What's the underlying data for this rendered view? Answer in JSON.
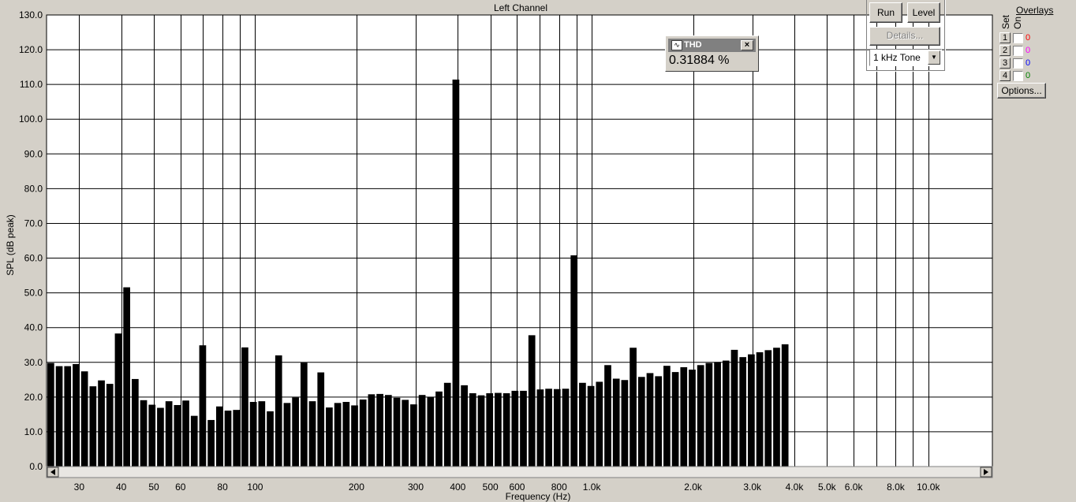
{
  "chart_data": {
    "type": "bar",
    "title": "Left Channel",
    "xlabel": "Frequency (Hz)",
    "ylabel": "SPL (dB peak)",
    "x_scale": "log",
    "xlim": [
      24,
      15500
    ],
    "ylim": [
      0,
      130
    ],
    "grid": true,
    "y_ticks": [
      "0.0",
      "10.0",
      "20.0",
      "30.0",
      "40.0",
      "50.0",
      "60.0",
      "70.0",
      "80.0",
      "90.0",
      "100.0",
      "110.0",
      "120.0",
      "130.0"
    ],
    "x_tick_labels": [
      {
        "label": "30",
        "value": 30
      },
      {
        "label": "40",
        "value": 40
      },
      {
        "label": "50",
        "value": 50
      },
      {
        "label": "60",
        "value": 60
      },
      {
        "label": "80",
        "value": 80
      },
      {
        "label": "100",
        "value": 100
      },
      {
        "label": "200",
        "value": 200
      },
      {
        "label": "300",
        "value": 300
      },
      {
        "label": "400",
        "value": 400
      },
      {
        "label": "500",
        "value": 500
      },
      {
        "label": "600",
        "value": 600
      },
      {
        "label": "800",
        "value": 800
      },
      {
        "label": "1.0k",
        "value": 1000
      },
      {
        "label": "2.0k",
        "value": 2000
      },
      {
        "label": "3.0k",
        "value": 3000
      },
      {
        "label": "4.0k",
        "value": 4000
      },
      {
        "label": "5.0k",
        "value": 5000
      },
      {
        "label": "6.0k",
        "value": 6000
      },
      {
        "label": "8.0k",
        "value": 8000
      },
      {
        "label": "10.0k",
        "value": 10000
      }
    ],
    "x_gridlines": [
      30,
      40,
      50,
      60,
      70,
      80,
      90,
      100,
      200,
      300,
      400,
      500,
      600,
      700,
      800,
      900,
      1000,
      2000,
      3000,
      4000,
      5000,
      6000,
      7000,
      8000,
      9000,
      10000
    ],
    "bar_width_octave_fraction": 0.0833,
    "values": [
      29.8,
      28.9,
      28.9,
      29.5,
      27.4,
      23.1,
      24.8,
      23.8,
      38.3,
      51.6,
      25.2,
      19.1,
      17.8,
      16.9,
      18.8,
      17.7,
      19.0,
      14.6,
      34.9,
      13.4,
      17.3,
      16.1,
      16.3,
      34.3,
      18.6,
      18.8,
      15.9,
      32.0,
      18.3,
      19.9,
      29.9,
      18.8,
      27.1,
      17.0,
      18.3,
      18.6,
      17.6,
      19.3,
      20.8,
      20.9,
      20.6,
      19.8,
      19.2,
      17.9,
      20.6,
      20.0,
      21.6,
      24.1,
      111.4,
      23.4,
      21.1,
      20.5,
      21.1,
      21.2,
      21.1,
      21.8,
      21.8,
      37.8,
      22.2,
      22.4,
      22.3,
      22.4,
      60.8,
      24.1,
      23.2,
      24.4,
      29.2,
      25.3,
      24.9,
      34.2,
      25.8,
      26.9,
      26.0,
      29.0,
      27.2,
      28.6,
      27.9,
      29.2,
      29.8,
      30.1,
      30.5,
      33.6,
      31.5,
      32.3,
      32.9,
      33.5,
      34.2,
      35.2
    ]
  },
  "thd": {
    "title": "THD",
    "value": "0.31884 %",
    "icon": "waveform-icon"
  },
  "controls": {
    "run_label": "Run",
    "level_label": "Level",
    "details_label": "Details...",
    "signal_selected": "1 kHz Tone"
  },
  "overlays": {
    "title": "Overlays",
    "set_label": "Set",
    "on_label": "On",
    "options_label": "Options...",
    "items": [
      {
        "set": "1",
        "count": "0",
        "color": "#ff0000"
      },
      {
        "set": "2",
        "count": "0",
        "color": "#ff00ff"
      },
      {
        "set": "3",
        "count": "0",
        "color": "#0000ff"
      },
      {
        "set": "4",
        "count": "0",
        "color": "#008000"
      }
    ]
  }
}
